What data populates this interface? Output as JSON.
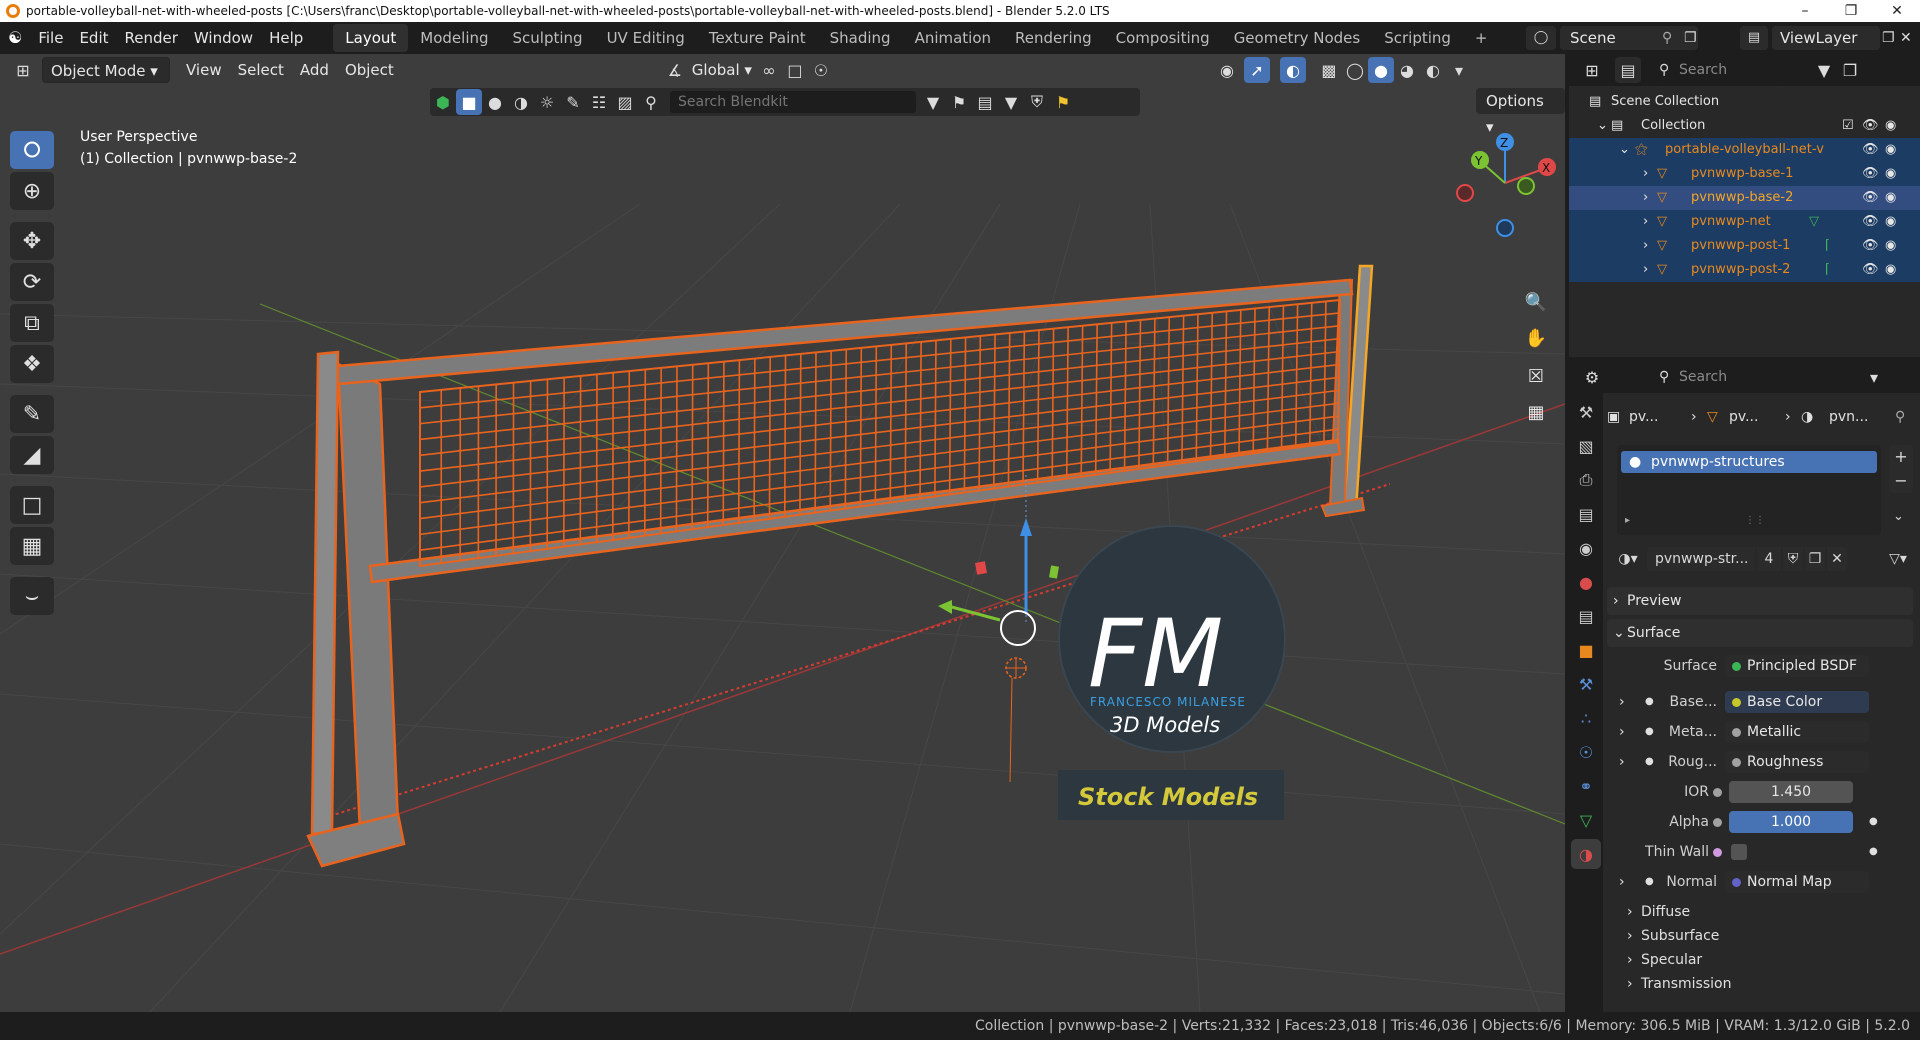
{
  "window": {
    "title": "portable-volleyball-net-with-wheeled-posts [C:\\Users\\franc\\Desktop\\portable-volleyball-net-with-wheeled-posts\\portable-volleyball-net-with-wheeled-posts.blend] - Blender 5.2.0 LTS",
    "controls": [
      "–",
      "❐",
      "✕"
    ]
  },
  "menu": [
    "File",
    "Edit",
    "Render",
    "Window",
    "Help"
  ],
  "workspaces": [
    "Layout",
    "Modeling",
    "Sculpting",
    "UV Editing",
    "Texture Paint",
    "Shading",
    "Animation",
    "Rendering",
    "Compositing",
    "Geometry Nodes",
    "Scripting",
    "+"
  ],
  "scene": {
    "name": "Scene",
    "view_layer": "ViewLayer"
  },
  "viewport": {
    "mode": "Object Mode",
    "menus": [
      "View",
      "Select",
      "Add",
      "Object"
    ],
    "orientation": "Global",
    "blendkit_placeholder": "Search Blendkit",
    "options_label": "Options",
    "perspective": "User Perspective",
    "collection_info": "(1) Collection | pvnwwp-base-2"
  },
  "watermark": {
    "logo": "FM",
    "brand": "FRANCESCO MILANESE",
    "sub": "3D Models",
    "banner": "Stock Models"
  },
  "outliner": {
    "search_placeholder": "Search",
    "scene_collection": "Scene Collection",
    "collection": "Collection",
    "parent": "portable-volleyball-net-v",
    "children": [
      "pvnwwp-base-1",
      "pvnwwp-base-2",
      "pvnwwp-net",
      "pvnwwp-post-1",
      "pvnwwp-post-2"
    ]
  },
  "properties": {
    "search_placeholder": "Search",
    "breadcrumb": [
      "pv...",
      "pv...",
      "pvn..."
    ],
    "material_slot": "pvnwwp-structures",
    "material_name": "pvnwwp-str...",
    "user_count": "4",
    "panels": {
      "preview": "Preview",
      "surface": "Surface"
    },
    "surface_label": "Surface",
    "surface_shader": "Principled BSDF",
    "inputs": [
      {
        "label": "Base...",
        "value": "Base Color",
        "dot": "#c7c729"
      },
      {
        "label": "Meta...",
        "value": "Metallic",
        "dot": "#a1a1a1"
      },
      {
        "label": "Roug...",
        "value": "Roughness",
        "dot": "#a1a1a1"
      }
    ],
    "ior": {
      "label": "IOR",
      "value": "1.450"
    },
    "alpha": {
      "label": "Alpha",
      "value": "1.000"
    },
    "thin_wall": {
      "label": "Thin Wall"
    },
    "normal": {
      "label": "Normal",
      "value": "Normal Map"
    },
    "subpanels": [
      "Diffuse",
      "Subsurface",
      "Specular",
      "Transmission"
    ]
  },
  "statusbar": "Collection | pvnwwp-base-2 | Verts:21,332 | Faces:23,018 | Tris:46,036 | Objects:6/6 | Memory: 306.5 MiB | VRAM: 1.3/12.0 GiB | 5.2.0",
  "colors": {
    "accent": "#4772b3",
    "selection_orange": "#e8641e",
    "active_object": "#f5a623",
    "shader_green": "#3cb557"
  }
}
